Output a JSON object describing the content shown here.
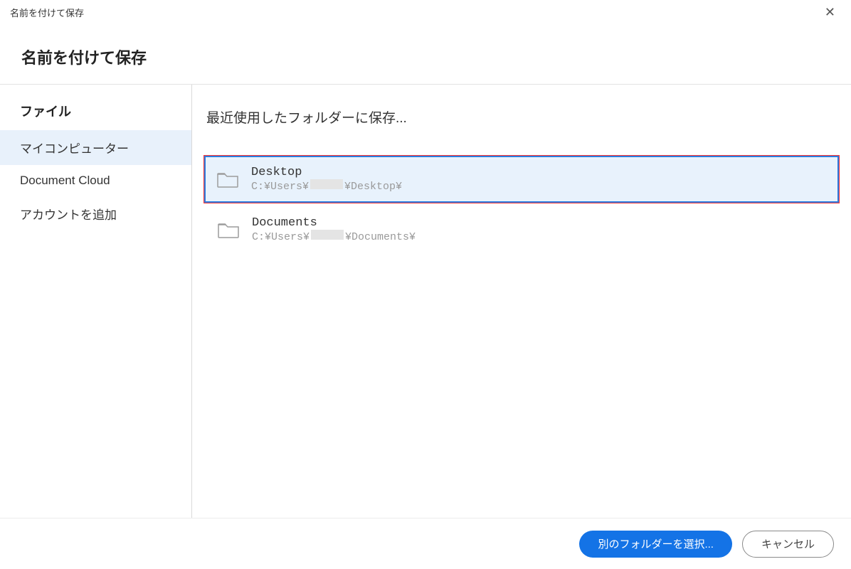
{
  "titlebar": {
    "title": "名前を付けて保存"
  },
  "heading": "名前を付けて保存",
  "sidebar": {
    "title": "ファイル",
    "items": [
      {
        "label": "マイコンピューター",
        "selected": true
      },
      {
        "label": "Document Cloud",
        "selected": false
      },
      {
        "label": "アカウントを追加",
        "selected": false
      }
    ]
  },
  "main": {
    "heading": "最近使用したフォルダーに保存...",
    "folders": [
      {
        "name": "Desktop",
        "path_prefix": "C:¥Users¥",
        "path_suffix": "¥Desktop¥",
        "selected": true
      },
      {
        "name": "Documents",
        "path_prefix": "C:¥Users¥",
        "path_suffix": "¥Documents¥",
        "selected": false
      }
    ]
  },
  "footer": {
    "choose": "別のフォルダーを選択...",
    "cancel": "キャンセル"
  }
}
